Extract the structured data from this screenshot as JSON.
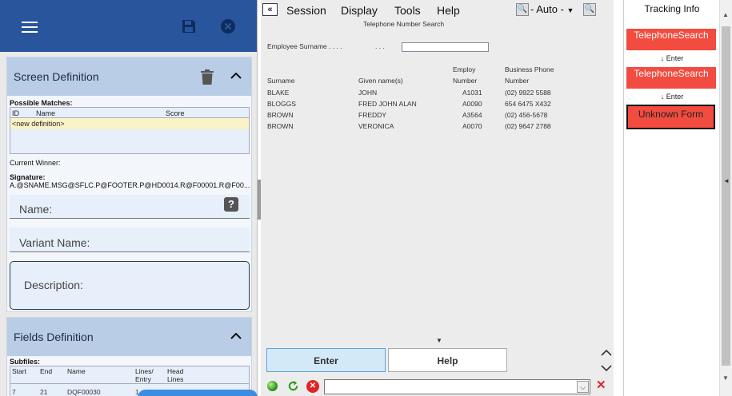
{
  "screen_definition": {
    "title": "Screen Definition",
    "possible_matches_label": "Possible Matches:",
    "columns": [
      "ID",
      "Name",
      "Score"
    ],
    "new_definition": "<new definition>",
    "current_winner_label": "Current Winner:",
    "signature_label": "Signature:",
    "signature_value": "A.@SNAME.MSG@SFLC.P@FOOTER.P@HD0014.R@F00001.R@F00...",
    "name_label": "Name:",
    "variant_label": "Variant Name:",
    "description_label": "Description:"
  },
  "fields_definition": {
    "title": "Fields Definition",
    "subfiles_label": "Subfiles:",
    "columns": [
      "Start",
      "End",
      "Name",
      "Lines/ Entry",
      "Head Lines"
    ],
    "row": [
      "7",
      "21",
      "DQF00030",
      "1",
      ""
    ]
  },
  "menu": {
    "back": "«",
    "items": [
      "Session",
      "Display",
      "Tools",
      "Help"
    ],
    "auto": "- Auto -"
  },
  "terminal": {
    "title": "Telephone Number Search",
    "surname_prompt": "Employee Surname . . . .",
    "surname_dots": ". . .",
    "headers": {
      "surname": "Surname",
      "given": "Given name(s)",
      "employ_top": "Employ",
      "employ_bottom": "Number",
      "phone_top": "Business Phone",
      "phone_bottom": "Number"
    },
    "rows": [
      [
        "BLAKE",
        "JOHN",
        "A1031",
        "(02) 9922 5588"
      ],
      [
        "BLOGGS",
        "FRED JOHN ALAN",
        "A0090",
        "654 6475 X432"
      ],
      [
        "BROWN",
        "FREDDY",
        "A3564",
        "(02) 456-5678"
      ],
      [
        "BROWN",
        "VERONICA",
        "A0070",
        "(02) 9647 2788"
      ]
    ]
  },
  "buttons": {
    "enter": "Enter",
    "help": "Help"
  },
  "tracking": {
    "title": "Tracking Info",
    "step1": "TelephoneSearch",
    "arrow1": "↓ Enter",
    "step2": "TelephoneSearch",
    "arrow2": "↓ Enter",
    "step3": "Unknown Form"
  },
  "colors": {
    "header_blue": "#28559c",
    "card_head": "#b9cde6",
    "track_red": "#f24b3f"
  }
}
